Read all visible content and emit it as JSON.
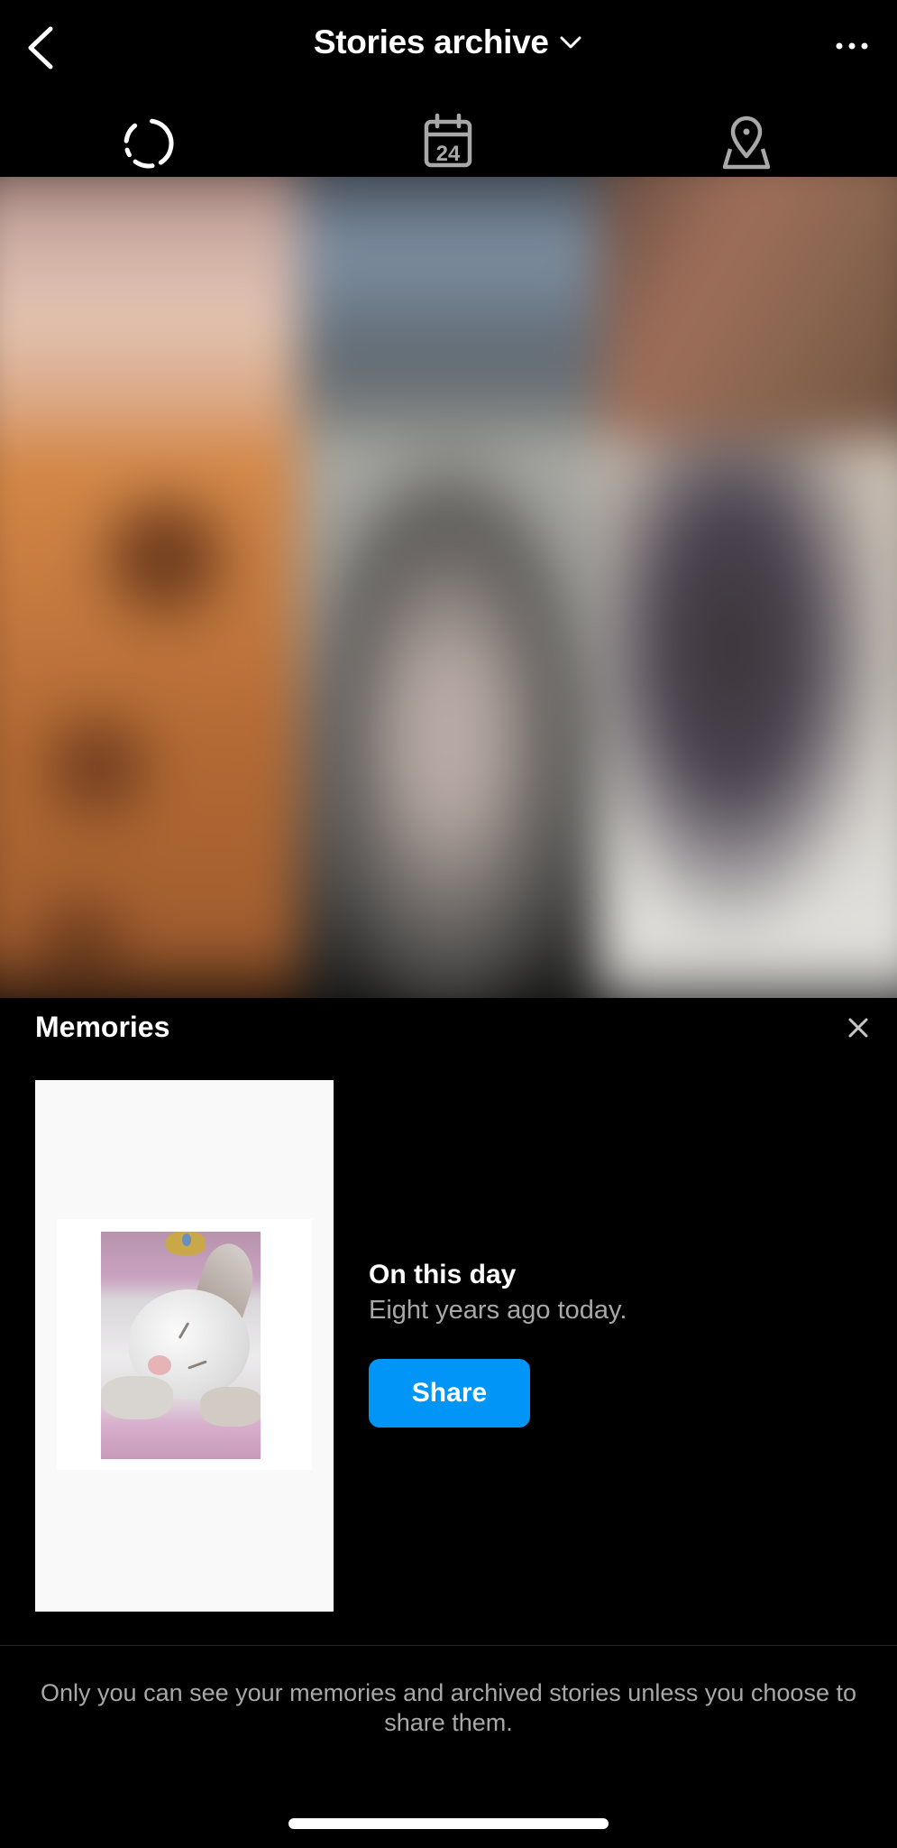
{
  "header": {
    "title": "Stories archive",
    "back_icon": "chevron-left-icon",
    "title_dropdown_icon": "chevron-down-icon",
    "more_icon": "more-horizontal-icon"
  },
  "tabs": [
    {
      "name": "stories",
      "icon": "dashed-circle-icon",
      "active": true
    },
    {
      "name": "calendar",
      "icon": "calendar-icon",
      "calendar_day": "24",
      "active": false
    },
    {
      "name": "map",
      "icon": "map-pin-icon",
      "active": false
    }
  ],
  "grid": {
    "tiles": [
      {
        "color": "#d8b3a3"
      },
      {
        "color": "#7f8c9b"
      },
      {
        "color": "#8f6a58"
      },
      {
        "color": "#b26a34"
      },
      {
        "color": "#75746f"
      },
      {
        "color": "#b9b4ae"
      }
    ]
  },
  "memories": {
    "title": "Memories",
    "close_icon": "close-icon",
    "card": {
      "title": "On this day",
      "subtitle": "Eight years ago today.",
      "share_label": "Share"
    }
  },
  "footer": {
    "note": "Only you can see your memories and archived stories unless you choose to share them."
  },
  "colors": {
    "background": "#000000",
    "accent": "#0095f6",
    "secondary_text": "#a8a8a8"
  }
}
